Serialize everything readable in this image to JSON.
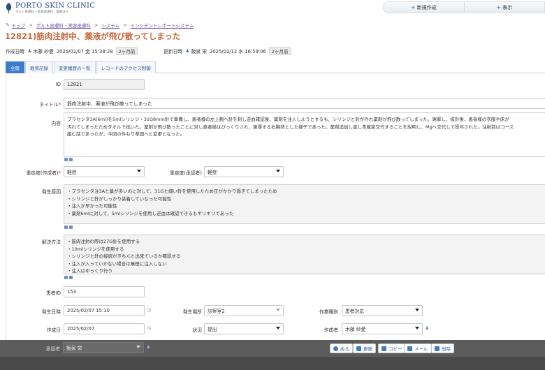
{
  "header": {
    "logo_name": "PORTO SKIN CLINIC",
    "logo_sub": "ポルト皮膚科・美容皮膚科　医療法人",
    "actions": [
      {
        "label": "新規作成"
      },
      {
        "label": "表示"
      }
    ]
  },
  "breadcrumb": {
    "items": [
      "トップ",
      "ポルト皮膚科・美容皮膚科",
      "システム",
      "インシデントレポートシステム"
    ]
  },
  "page": {
    "title": "12821)筋肉注射中、薬液が飛び散ってしまった"
  },
  "meta": {
    "created_label": "作成日時",
    "created_user": "木藤 紗愛",
    "created_at": "2025/02/07 金 15:38:28",
    "created_ago": "2ヶ月前",
    "updated_label": "更新日時",
    "updated_user": "飯泉 栄",
    "updated_at": "2025/02/12 水 16:59:06",
    "updated_ago": "2ヶ月前"
  },
  "tabs": [
    {
      "label": "全般",
      "active": true
    },
    {
      "label": "教育記録",
      "active": false
    },
    {
      "label": "変更履歴の一覧",
      "active": false
    },
    {
      "label": "レコードのアクセス制御",
      "active": false
    }
  ],
  "form": {
    "id": {
      "label": "ID",
      "value": "12821"
    },
    "title": {
      "label": "タイトル",
      "required": "*",
      "value": "筋肉注射中、薬液が飛び散ってしまった"
    },
    "content": {
      "label": "内容",
      "lines": [
        "プラセンタ3A(6ml)を5mlシリンジ・31G8mm針で準備し、患者様の左上腕へ針を刺し逆血確認後、薬剤を注入しようとするも、シリンジと針が外れ薬剤が飛び散ってしまった。謝罪し、抜針後、患者様の衣服や床が",
        "汚れてしまったためタオルで拭いた。薬剤が飛び散ったことに対し患者様はびっくりされ、謝罪する右胸然とした様子であった。薬剤追加し直し青蔵家交代することを説明し、Mgへ交代して投与された。注射前はコース",
        "組む話であったが、今回の件もり準固へと変更となった。"
      ]
    },
    "severity_reporter": {
      "label": "重症度(作成者)",
      "required": "*",
      "value": "軽症"
    },
    "severity_approver": {
      "label": "重症度(承認者)",
      "value": "軽症"
    },
    "cause": {
      "label": "発生原因",
      "lines": [
        "・プラセンタ注3Aと量が多いのに対して、31Gと細い針を使用したため圧がかかり過ぎてしまったため",
        "・シリンジと針がしっかり装着していなった可能性",
        "・注入が早かった可能性",
        "・薬剤6mlに対して、5mlシリンジを使用し逆血は確認できるもギリギリであった"
      ]
    },
    "solution": {
      "label": "解決方法",
      "lines": [
        "・筋肉注射の際は27G針を使用する",
        "・10mlシリンジを使用する",
        "・シリンジと針の接続がきちんと出来ているか確認する",
        "・注入が入っていかない場合は無理に注入しない",
        "・注入はゆっくり行う"
      ]
    },
    "patient_id": {
      "label": "患者ID",
      "value": "153"
    },
    "occurred_at": {
      "label": "発生日時",
      "value": "2025/02/07 15:10"
    },
    "place": {
      "label": "発生場所",
      "value": "診察室2"
    },
    "work_type": {
      "label": "作業種別",
      "value": "患者対応"
    },
    "created_date": {
      "label": "作成日",
      "value": "2025/02/07"
    },
    "status": {
      "label": "状況",
      "value": "提出"
    },
    "author": {
      "label": "作成者",
      "value": "木藤 紗愛"
    },
    "approver": {
      "label": "承認者",
      "value": "飯泉 栄"
    }
  },
  "footer": {
    "buttons": [
      {
        "label": "戻る"
      },
      {
        "label": "更新"
      },
      {
        "label": "コピー"
      },
      {
        "label": "メール"
      },
      {
        "label": "削除"
      }
    ]
  },
  "colors": {
    "title": "#c8663a",
    "tab_active": "#3d7cc9",
    "brand": "#2d4d86"
  }
}
